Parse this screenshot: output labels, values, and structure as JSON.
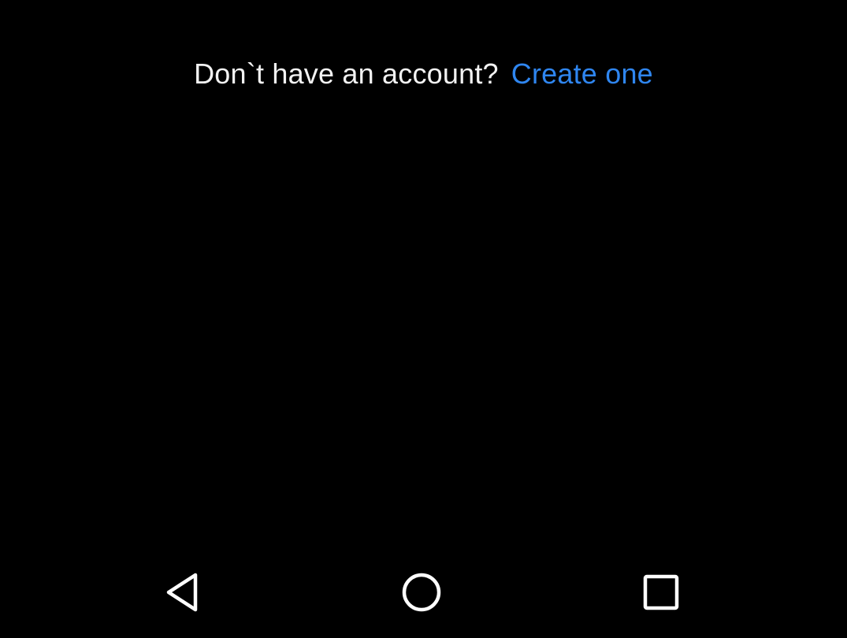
{
  "signup": {
    "prompt": "Don`t have an account?",
    "link_label": "Create one"
  },
  "colors": {
    "background": "#000000",
    "text": "#f2f2f2",
    "link": "#2f86f0",
    "nav_icon": "#ffffff"
  },
  "navigation": {
    "buttons": [
      {
        "name": "back",
        "icon": "back-triangle-icon"
      },
      {
        "name": "home",
        "icon": "home-circle-icon"
      },
      {
        "name": "recents",
        "icon": "recents-square-icon"
      }
    ]
  }
}
